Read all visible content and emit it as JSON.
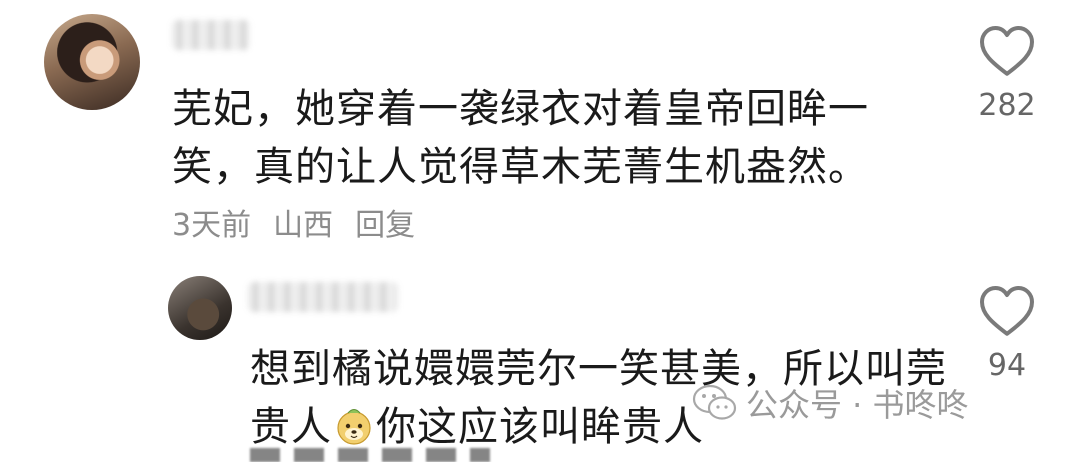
{
  "comments": [
    {
      "text": "芜妃，她穿着一袭绿衣对着皇帝回眸一笑，真的让人觉得草木芜菁生机盎然。",
      "meta": {
        "time": "3天前",
        "location": "山西",
        "reply": "回复"
      },
      "likes": "282"
    },
    {
      "text_before_emoji": "想到橘说嬛嬛莞尔一笑甚美，所以叫莞贵人",
      "emoji_name": "dog-face-emoji",
      "text_after_emoji": "你这应该叫眸贵人",
      "likes": "94"
    }
  ],
  "watermark": {
    "label": "公众号 · 书咚咚",
    "icon": "wechat-icon"
  }
}
